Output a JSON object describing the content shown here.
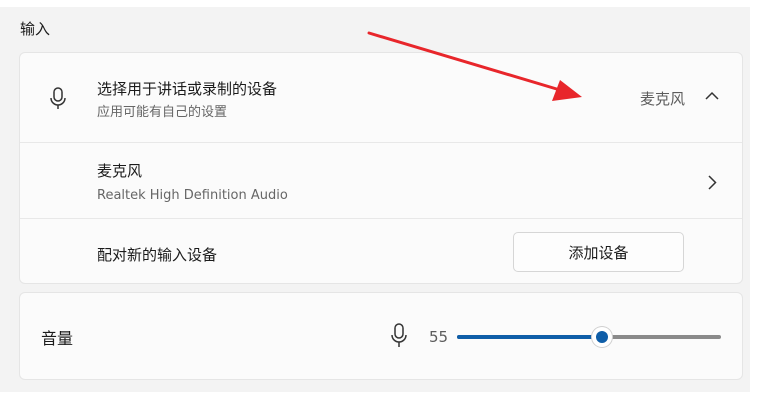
{
  "section": {
    "title": "输入"
  },
  "device_select": {
    "title": "选择用于讲话或录制的设备",
    "subtitle": "应用可能有自己的设置",
    "selected": "麦克风"
  },
  "device_item": {
    "name": "麦克风",
    "description": "Realtek High Definition Audio"
  },
  "pair": {
    "label": "配对新的输入设备",
    "button_label": "添加设备"
  },
  "volume": {
    "label": "音量",
    "value": "55",
    "level_percent": 55
  },
  "icons": {
    "mic": "microphone-icon",
    "chevron_up": "chevron-up-icon",
    "chevron_right": "chevron-right-icon"
  },
  "colors": {
    "accent": "#0f5ea8",
    "annotation_arrow": "#e8262b",
    "track": "#8a8a8a"
  }
}
